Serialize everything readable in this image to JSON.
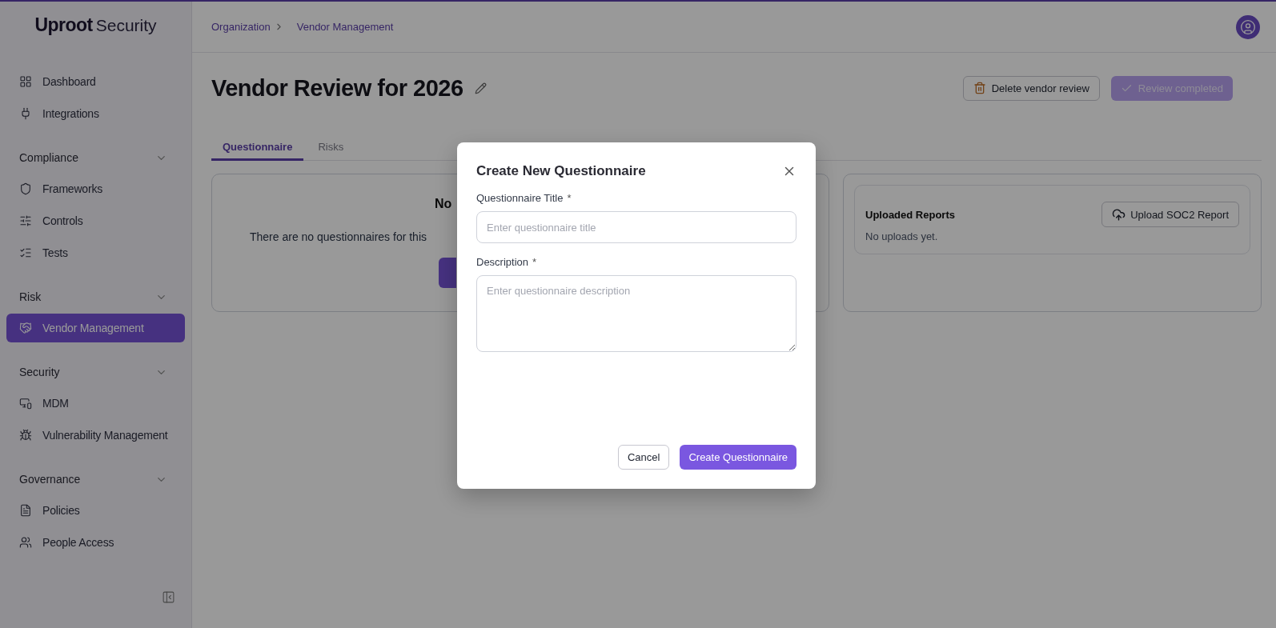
{
  "sidebar": {
    "logo": {
      "brand": "Uproot",
      "suffix": "Security"
    },
    "groups": [
      {
        "items": [
          {
            "label": "Dashboard",
            "selected": false
          },
          {
            "label": "Integrations",
            "selected": false
          }
        ]
      },
      {
        "title": "Compliance",
        "expanded": true,
        "items": [
          {
            "label": "Frameworks",
            "selected": false
          },
          {
            "label": "Controls",
            "selected": false
          },
          {
            "label": "Tests",
            "selected": false
          }
        ]
      },
      {
        "title": "Risk",
        "expanded": true,
        "items": [
          {
            "label": "Vendor Management",
            "selected": true
          }
        ]
      },
      {
        "title": "Security",
        "expanded": true,
        "items": [
          {
            "label": "MDM",
            "selected": false
          },
          {
            "label": "Vulnerability Management",
            "selected": false
          }
        ]
      },
      {
        "title": "Governance",
        "expanded": true,
        "items": [
          {
            "label": "Policies",
            "selected": false
          },
          {
            "label": "People Access",
            "selected": false
          }
        ]
      }
    ]
  },
  "breadcrumb": [
    "Organization",
    "Vendor Management"
  ],
  "page": {
    "title": "Vendor Review for 2026",
    "actions": [
      {
        "label": "Delete vendor review",
        "kind": "delete"
      },
      {
        "label": "Review completed",
        "kind": "complete",
        "disabled": true
      }
    ]
  },
  "tabs": [
    {
      "label": "Questionnaire",
      "selected": true
    },
    {
      "label": "Risks",
      "selected": false
    }
  ],
  "questionnaire_card": {
    "heading": "No",
    "text": "There are no questionnaires for this"
  },
  "reports_card": {
    "title": "Uploaded Reports",
    "button": "Upload SOC2 Report",
    "empty_text": "No uploads yet."
  },
  "modal": {
    "title": "Create New Questionnaire",
    "fields": [
      {
        "label": "Questionnaire Title",
        "marker": "*",
        "kind": "input",
        "placeholder": "Enter questionnaire title"
      },
      {
        "label": "Description",
        "marker": "*",
        "kind": "textarea",
        "placeholder": "Enter questionnaire description"
      }
    ],
    "buttons": [
      {
        "label": "Cancel",
        "kind": "secondary"
      },
      {
        "label": "Create Questionnaire",
        "kind": "primary"
      }
    ]
  }
}
